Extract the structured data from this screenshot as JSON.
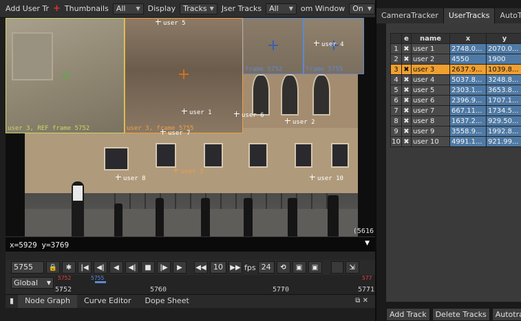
{
  "toolbar": {
    "add_user_track": "Add User Tr",
    "thumbnails_label": "Thumbnails",
    "thumbnails_value": "All",
    "display_label": "Display",
    "display_value": "Tracks",
    "user_tracks_label": "Jser Tracks",
    "user_tracks_value": "All",
    "zoom_window_label": "om Window",
    "zoom_window_value": "On"
  },
  "viewer": {
    "thumbnails": [
      {
        "label": "user 3, REF frame 5752",
        "color": "#c7d86a"
      },
      {
        "label": "user 3, frame 5755",
        "color": "#f0a040"
      },
      {
        "label": "frame 5752",
        "color": "#5a8ad8"
      },
      {
        "label": "frame 5755",
        "color": "#5a8ad8"
      }
    ],
    "track_labels": [
      "user 1",
      "user 2",
      "user 3",
      "user 4",
      "user 5",
      "user 6",
      "user 7",
      "user 8",
      "user 10"
    ],
    "corner_label": "(5616"
  },
  "coord_readout": "x=5929 y=3769",
  "transport": {
    "current_frame": "5755",
    "step": "10",
    "fps_label": "fps",
    "fps_value": "24"
  },
  "timeline": {
    "scope": "Global",
    "ruler_labels": [
      "5752",
      "5760",
      "5770",
      "5771"
    ],
    "marker_red_left": "5752",
    "marker_blue": "5755",
    "marker_red_right": "577"
  },
  "bottom_tabs": [
    "Node Graph",
    "Curve Editor",
    "Dope Sheet"
  ],
  "panel": {
    "tabs": [
      "CameraTracker",
      "UserTracks",
      "AutoTr"
    ],
    "table_headers": [
      "",
      "e",
      "name",
      "x",
      "y"
    ],
    "rows": [
      {
        "idx": "1",
        "name": "user 1",
        "x": "2748.0...",
        "y": "2070.0..."
      },
      {
        "idx": "2",
        "name": "user 2",
        "x": "4550",
        "y": "1900"
      },
      {
        "idx": "3",
        "name": "user 3",
        "x": "2637.9...",
        "y": "1039.8..."
      },
      {
        "idx": "4",
        "name": "user 4",
        "x": "5037.8...",
        "y": "3248.8..."
      },
      {
        "idx": "5",
        "name": "user 5",
        "x": "2303.1...",
        "y": "3653.8..."
      },
      {
        "idx": "6",
        "name": "user 6",
        "x": "2396.9...",
        "y": "1707.1..."
      },
      {
        "idx": "7",
        "name": "user 7",
        "x": "667.11...",
        "y": "1734.5..."
      },
      {
        "idx": "8",
        "name": "user 8",
        "x": "1637.2...",
        "y": "929.50..."
      },
      {
        "idx": "9",
        "name": "user 9",
        "x": "3558.9...",
        "y": "1992.8..."
      },
      {
        "idx": "10",
        "name": "user 10",
        "x": "4991.1...",
        "y": "921.99..."
      }
    ],
    "selected_row": 2,
    "buttons": [
      "Add Track",
      "Delete Tracks",
      "Autotrack"
    ]
  },
  "colors": {
    "selection": "#f0a030",
    "value_cell": "#4f7aa5",
    "ref_thumb": "#c7d86a",
    "zoom_thumb": "#5a8ad8"
  }
}
